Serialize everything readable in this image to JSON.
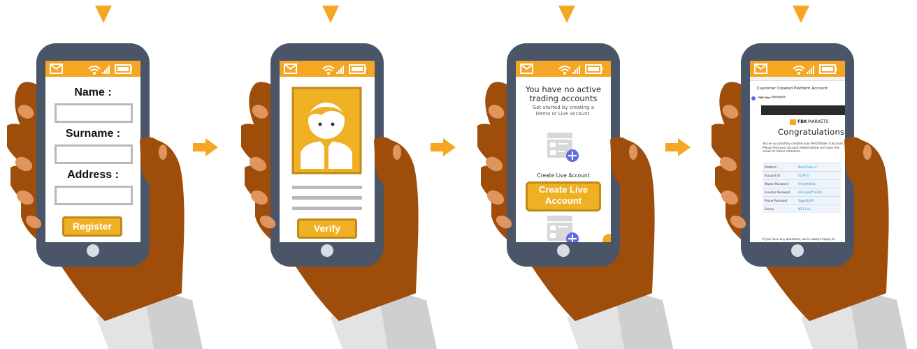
{
  "steps": [
    {
      "fields": [
        {
          "label": "Name :"
        },
        {
          "label": "Surname :"
        },
        {
          "label": "Address :"
        }
      ],
      "button_label": "Register"
    },
    {
      "button_label": "Verify"
    },
    {
      "headline": "You have no active trading accounts",
      "subtext": "Get started by creating a Demo or Live account.",
      "section_label": "Create Live Account",
      "button_label": "Create Live Account"
    },
    {
      "email_subject": "Customer Created Platform Account",
      "sender": "FBK Markets",
      "sender_tag": "Summarize",
      "brand": "FBK MARKETS",
      "brand_short": "FBK",
      "brand_rest": "MARKETS",
      "heading": "Congratulations!",
      "intro": "You've successfully created your MetaTrader 4 account. Please find your account details below and save this email for future reference.",
      "rows": [
        {
          "key": "Platform",
          "value": "MetaTrader 4"
        },
        {
          "key": "Account ID",
          "value": "410971"
        },
        {
          "key": "Master Password",
          "value": "fm!plm8A4a"
        },
        {
          "key": "Investor Password",
          "value": "4Aicuqn8fYm243"
        },
        {
          "key": "Phone Password",
          "value": "5qjgrt4jAM"
        },
        {
          "key": "Server",
          "value": "MT4 Live"
        }
      ],
      "footer": "If you have any questions, we're always happy to"
    }
  ],
  "colors": {
    "accent": "#F5A623",
    "button": "#F0B024",
    "phone": "#4A5568",
    "skin": "#9E4D0B",
    "nail": "#E0955E",
    "sleeve": "#E3E3E3",
    "link": "#1A9AD6",
    "plus": "#5B6EE1"
  },
  "icons": [
    "envelope-icon",
    "wifi-icon",
    "signal-icon",
    "battery-icon",
    "avatar-icon",
    "account-card-icon",
    "plus-icon",
    "arrow-right-icon"
  ]
}
